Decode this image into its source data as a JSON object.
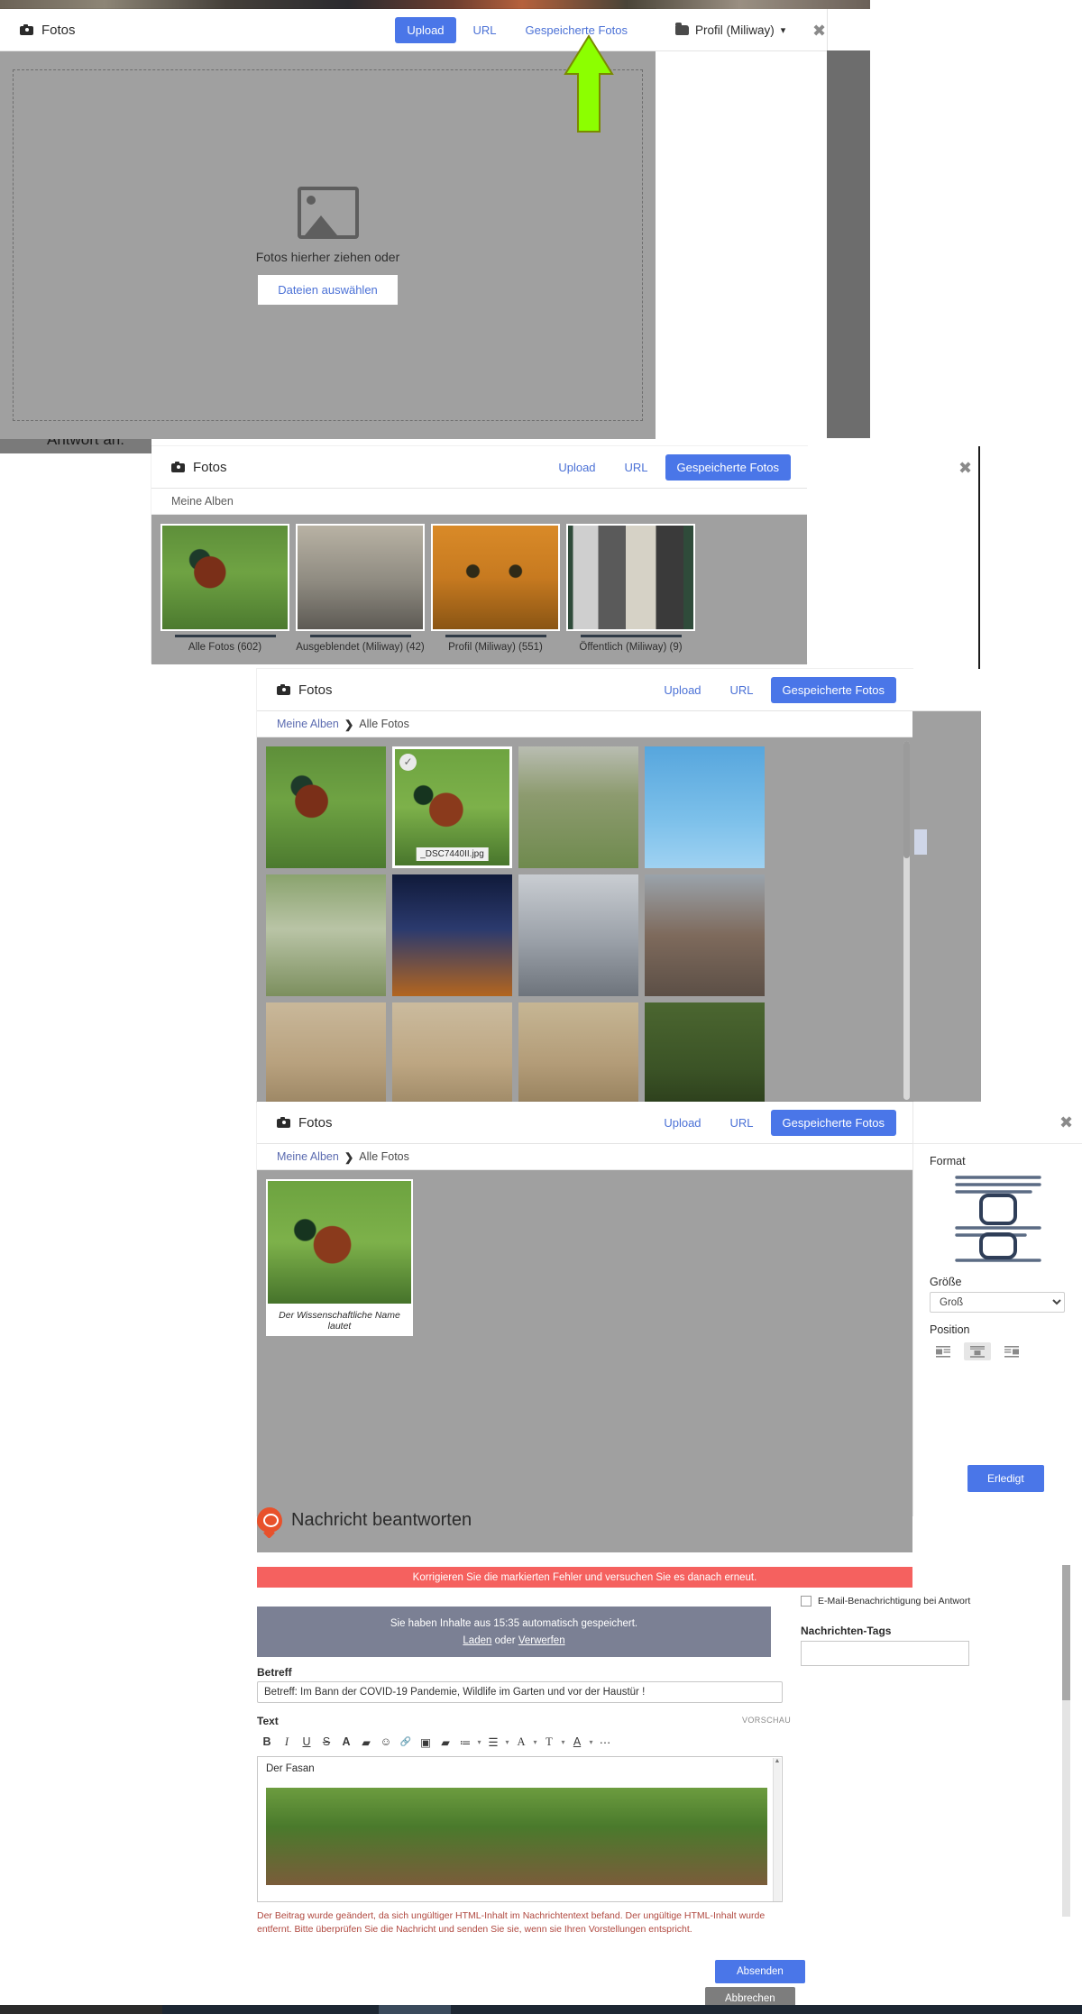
{
  "page": {
    "reply_to_label": "Antwort an:"
  },
  "dialog1": {
    "title": "Fotos",
    "tabs": [
      {
        "label": "Upload",
        "active": true
      },
      {
        "label": "URL",
        "active": false
      },
      {
        "label": "Gespeicherte Fotos",
        "active": false
      }
    ],
    "dropzone_text": "Fotos hierher ziehen oder",
    "dropzone_button": "Dateien auswählen",
    "profile_select": "Profil (Miliway)",
    "done_button": "Erledigt",
    "close": "✖"
  },
  "dialog2": {
    "title": "Fotos",
    "tabs": [
      {
        "label": "Upload",
        "active": false
      },
      {
        "label": "URL",
        "active": false
      },
      {
        "label": "Gespeicherte Fotos",
        "active": true
      }
    ],
    "breadcrumb": "Meine Alben",
    "albums": [
      {
        "label": "Alle Fotos (602)",
        "thumb": "ph-pheasant"
      },
      {
        "label": "Ausgeblendet (Miliway) (42)",
        "thumb": "ph-heli"
      },
      {
        "label": "Profil (Miliway) (551)",
        "thumb": "ph-tiger"
      },
      {
        "label": "Öffentlich (Miliway) (9)",
        "thumb": "ph-shelf"
      }
    ],
    "close": "✖"
  },
  "dialog3": {
    "title": "Fotos",
    "tabs": [
      {
        "label": "Upload",
        "active": false
      },
      {
        "label": "URL",
        "active": false
      },
      {
        "label": "Gespeicherte Fotos",
        "active": true
      }
    ],
    "breadcrumb_root": "Meine Alben",
    "breadcrumb_sep": "❯",
    "breadcrumb_current": "Alle Fotos",
    "photos": [
      {
        "thumb": "ph-pheasant",
        "selected": false,
        "filename": ""
      },
      {
        "thumb": "ph-pheasant2",
        "selected": true,
        "filename": "_DSC7440II.jpg"
      },
      {
        "thumb": "ph-garden",
        "selected": false,
        "filename": ""
      },
      {
        "thumb": "ph-hawk",
        "selected": false,
        "filename": ""
      },
      {
        "thumb": "ph-jet",
        "selected": false,
        "filename": ""
      },
      {
        "thumb": "ph-church",
        "selected": false,
        "filename": ""
      },
      {
        "thumb": "ph-dome",
        "selected": false,
        "filename": ""
      },
      {
        "thumb": "ph-market",
        "selected": false,
        "filename": ""
      },
      {
        "thumb": "ph-finch",
        "selected": false,
        "filename": ""
      },
      {
        "thumb": "ph-finch2",
        "selected": false,
        "filename": ""
      },
      {
        "thumb": "ph-finch3",
        "selected": false,
        "filename": ""
      },
      {
        "thumb": "ph-goldfinch",
        "selected": false,
        "filename": ""
      }
    ],
    "check_glyph": "✓"
  },
  "dialog4": {
    "title": "Fotos",
    "tabs": [
      {
        "label": "Upload",
        "active": false
      },
      {
        "label": "URL",
        "active": false
      },
      {
        "label": "Gespeicherte Fotos",
        "active": true
      }
    ],
    "breadcrumb_root": "Meine Alben",
    "breadcrumb_sep": "❯",
    "breadcrumb_current": "Alle Fotos",
    "preview_caption": "Der Wissenschaftliche Name lautet",
    "format_label": "Format",
    "size_label": "Größe",
    "size_value": "Groß",
    "size_options": [
      "Groß"
    ],
    "position_label": "Position",
    "position_selected_index": 1,
    "done_button": "Erledigt",
    "close": "✖"
  },
  "form": {
    "heading": "Nachricht beantworten",
    "error_banner": "Korrigieren Sie die markierten Fehler und versuchen Sie es danach erneut.",
    "autosave_text": "Sie haben Inhalte aus 15:35 automatisch gespeichert.",
    "autosave_load": "Laden",
    "autosave_or": " oder ",
    "autosave_discard": "Verwerfen",
    "subject_label": "Betreff",
    "subject_value": "Betreff: Im Bann der COVID-19 Pandemie, Wildlife im Garten und vor der Haustür !",
    "text_label": "Text",
    "preview_label": "VORSCHAU",
    "toolbar_icons": [
      {
        "name": "bold-icon",
        "glyph": "B"
      },
      {
        "name": "italic-icon",
        "glyph": "I"
      },
      {
        "name": "underline-icon",
        "glyph": "U"
      },
      {
        "name": "strikethrough-icon",
        "glyph": "S"
      },
      {
        "name": "text-color-icon",
        "glyph": "A"
      },
      {
        "name": "video-icon",
        "glyph": "▰"
      },
      {
        "name": "emoji-icon",
        "glyph": "☺"
      },
      {
        "name": "link-icon",
        "glyph": "🔗"
      },
      {
        "name": "photo-icon",
        "glyph": "▣"
      },
      {
        "name": "media-icon",
        "glyph": "▰"
      },
      {
        "name": "ordered-list-icon",
        "glyph": "≔"
      },
      {
        "name": "unordered-list-icon",
        "glyph": "☰"
      },
      {
        "name": "font-family-icon",
        "glyph": "A"
      },
      {
        "name": "font-size-icon",
        "glyph": "T"
      },
      {
        "name": "highlight-icon",
        "glyph": "A"
      },
      {
        "name": "more-icon",
        "glyph": "⋯"
      }
    ],
    "editor_text": "Der Fasan",
    "html_note": "Der Beitrag wurde geändert, da sich ungültiger HTML-Inhalt im Nachrichtentext befand. Der ungültige HTML-Inhalt wurde entfernt. Bitte überprüfen Sie die Nachricht und senden Sie sie, wenn sie Ihren Vorstellungen entspricht.",
    "submit_button": "Absenden",
    "cancel_button": "Abbrechen",
    "email_notify_label": "E-Mail-Benachrichtigung bei Antwort",
    "tags_label": "Nachrichten-Tags",
    "tags_value": ""
  },
  "colors": {
    "accent_blue": "#4a76e8",
    "link_blue": "#4b71d6",
    "error_red": "#f5615f",
    "warn_text": "#b0483f",
    "annotation_green": "#8cff00",
    "dialog_body_grey": "#a0a0a0"
  }
}
